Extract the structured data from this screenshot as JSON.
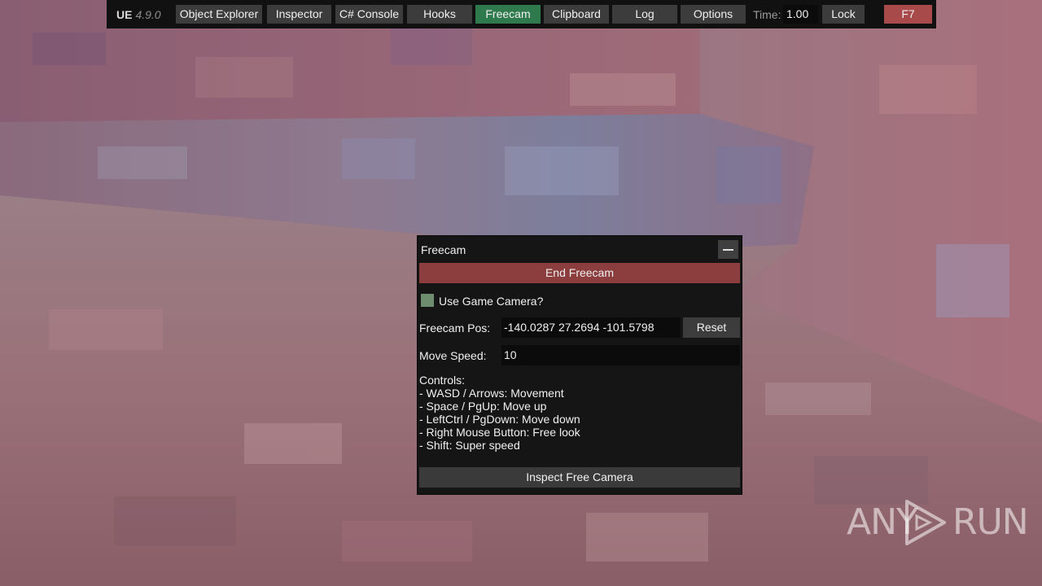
{
  "toolbar": {
    "app_name": "UE",
    "version": "4.9.0",
    "buttons": [
      {
        "label": "Object Explorer",
        "active": false
      },
      {
        "label": "Inspector",
        "active": false
      },
      {
        "label": "C# Console",
        "active": false
      },
      {
        "label": "Hooks",
        "active": false
      },
      {
        "label": "Freecam",
        "active": true
      },
      {
        "label": "Clipboard",
        "active": false
      },
      {
        "label": "Log",
        "active": false
      },
      {
        "label": "Options",
        "active": false
      }
    ],
    "time_label": "Time:",
    "time_value": "1.00",
    "lock_label": "Lock",
    "hotkey_label": "F7"
  },
  "freecam_panel": {
    "title": "Freecam",
    "end_button": "End Freecam",
    "use_game_camera_label": "Use Game Camera?",
    "use_game_camera_checked": false,
    "pos_label": "Freecam Pos:",
    "pos_value": "-140.0287 27.2694 -101.5798",
    "reset_button": "Reset",
    "speed_label": "Move Speed:",
    "speed_value": "10",
    "controls_lines": [
      "Controls:",
      "- WASD / Arrows: Movement",
      "- Space / PgUp: Move up",
      "- LeftCtrl / PgDown: Move down",
      "- Right Mouse Button: Free look",
      "- Shift: Super speed"
    ],
    "inspect_button": "Inspect Free Camera"
  },
  "watermark": {
    "left": "ANY",
    "right": "RUN"
  },
  "colors": {
    "toolbar_bg": "#111111",
    "button_bg": "#3c3c3c",
    "active_button_bg": "#2f7a4d",
    "hotkey_button_bg": "#a94a4a",
    "panel_bg": "#151515",
    "end_button_bg": "#8c3d3d",
    "checkbox_bg": "#6e8c6e"
  }
}
